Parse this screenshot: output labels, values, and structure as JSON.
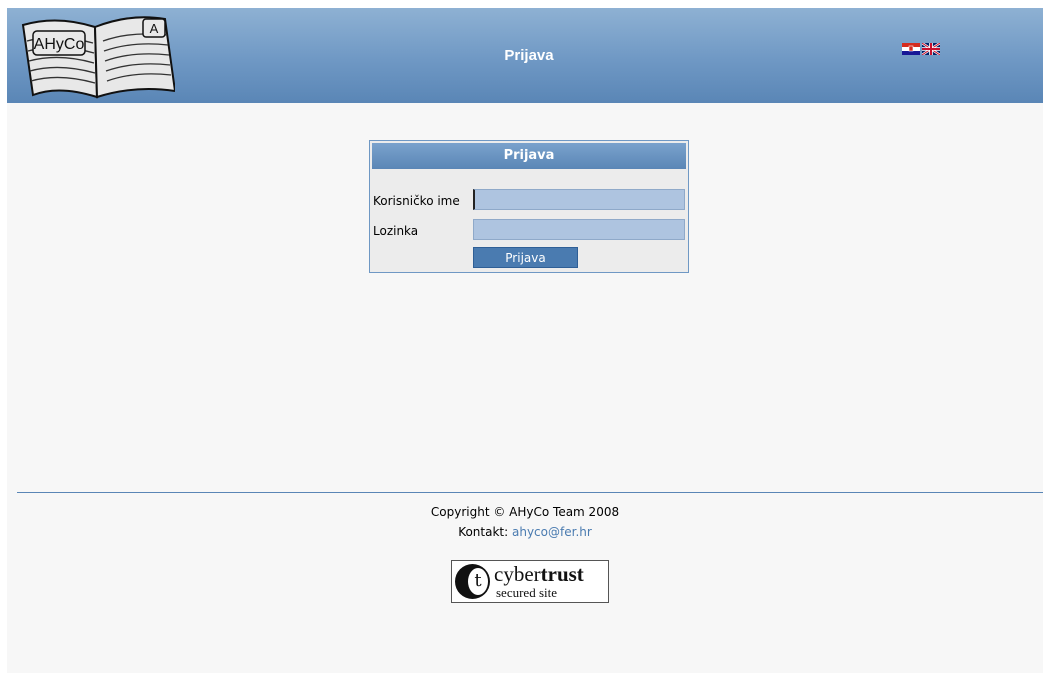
{
  "header": {
    "title": "Prijava",
    "logo_text": "AHyCo",
    "logo_letter": "A",
    "flags": [
      {
        "name": "croatian-flag-icon",
        "lang": "hr"
      },
      {
        "name": "uk-flag-icon",
        "lang": "en"
      }
    ]
  },
  "login": {
    "title": "Prijava",
    "username_label": "Korisničko ime",
    "username_value": "",
    "password_label": "Lozinka",
    "password_value": "",
    "submit_label": "Prijava"
  },
  "footer": {
    "copyright": "Copyright © AHyCo Team 2008",
    "contact_label": "Kontakt:",
    "contact_email": "ahyco@fer.hr",
    "badge": {
      "letter": "t",
      "brand_thin": "cyber",
      "brand_bold": "trust",
      "subtitle": "secured site"
    }
  },
  "colors": {
    "header_blue": "#6f98c4",
    "button_blue": "#4a7bb0",
    "input_bg": "#aec4e0",
    "page_bg": "#f7f7f7"
  }
}
